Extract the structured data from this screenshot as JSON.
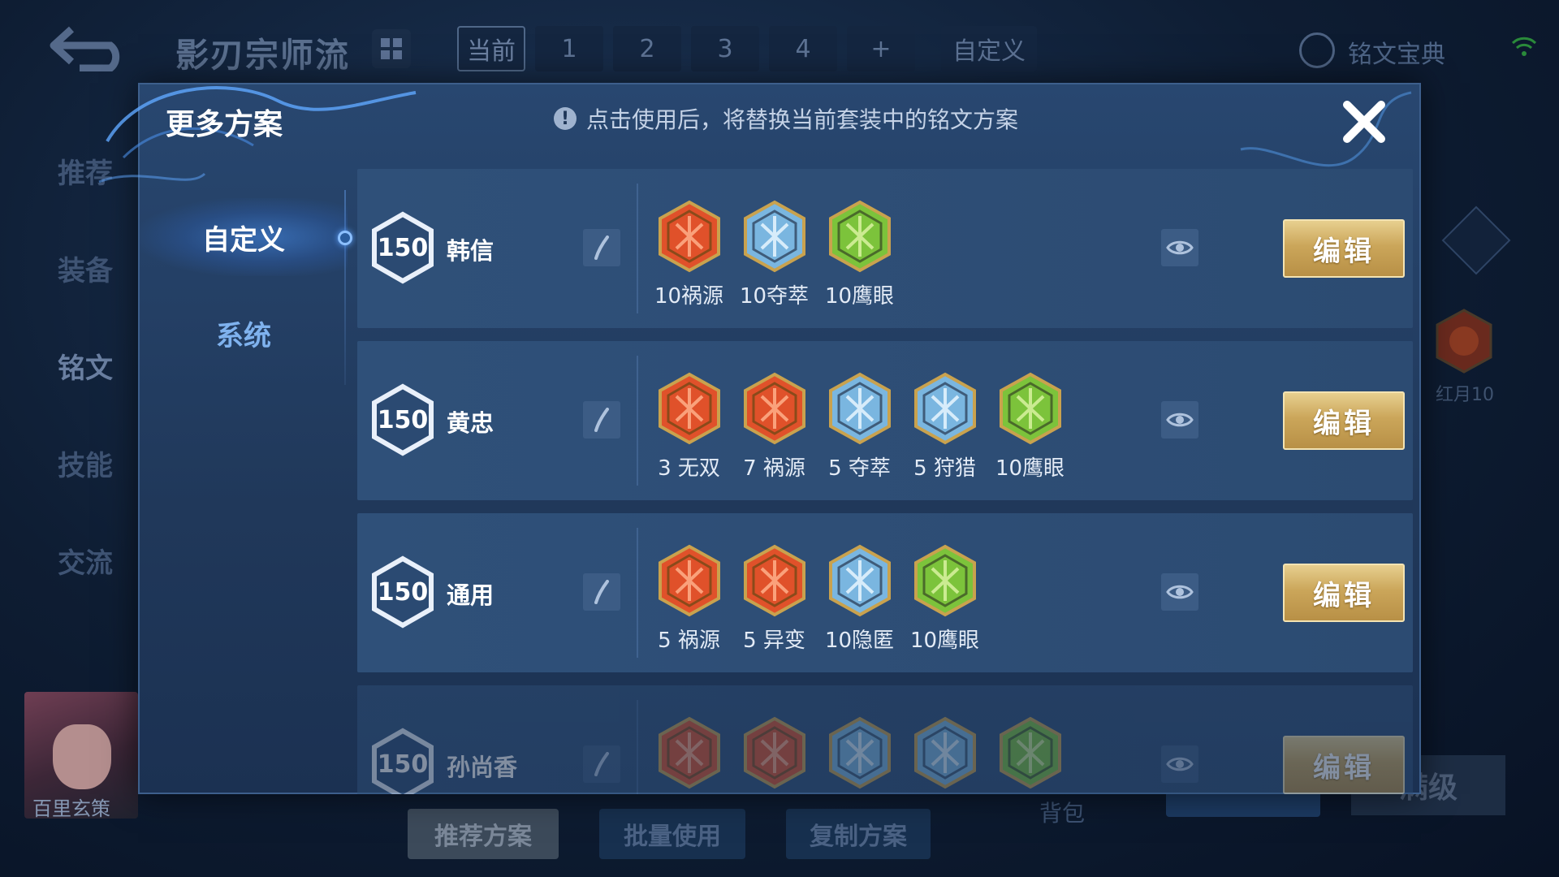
{
  "top_bar": {
    "title": "影刃宗师流",
    "tabs": [
      "当前",
      "1",
      "2",
      "3",
      "4",
      "+"
    ],
    "custom_tab": "自定义",
    "codex_label": "铭文宝典"
  },
  "left_nav": [
    "推荐",
    "装备",
    "铭文",
    "技能",
    "交流"
  ],
  "hero": {
    "name": "百里玄策"
  },
  "side": {
    "gem_label": "红月10"
  },
  "bottom": {
    "recommend": "推荐方案",
    "batch_use": "批量使用",
    "copy_plan": "复制方案",
    "bag": "背包",
    "full_level": "满级"
  },
  "modal": {
    "title": "更多方案",
    "notice_icon": "!",
    "notice": "点击使用后，将替换当前套装中的铭文方案",
    "tabs": [
      "自定义",
      "系统"
    ],
    "active_tab": "自定义",
    "edit_label": "编辑",
    "plans": [
      {
        "level": "150",
        "name": "韩信",
        "runes": [
          {
            "icon": "red-rune-icon",
            "label": "10祸源"
          },
          {
            "icon": "blue-rune-icon",
            "label": "10夺萃"
          },
          {
            "icon": "green-rune-icon",
            "label": "10鹰眼"
          }
        ]
      },
      {
        "level": "150",
        "name": "黄忠",
        "runes": [
          {
            "icon": "red-rune-icon",
            "label": "3 无双"
          },
          {
            "icon": "red-rune-icon",
            "label": "7 祸源"
          },
          {
            "icon": "blue-rune-icon",
            "label": "5 夺萃"
          },
          {
            "icon": "blue-rune-icon",
            "label": "5 狩猎"
          },
          {
            "icon": "green-rune-icon",
            "label": "10鹰眼"
          }
        ]
      },
      {
        "level": "150",
        "name": "通用",
        "runes": [
          {
            "icon": "red-rune-icon",
            "label": "5 祸源"
          },
          {
            "icon": "red-rune-icon",
            "label": "5 异变"
          },
          {
            "icon": "blue-rune-icon",
            "label": "10隐匿"
          },
          {
            "icon": "green-rune-icon",
            "label": "10鹰眼"
          }
        ]
      },
      {
        "level": "150",
        "name": "孙尚香",
        "runes": [
          {
            "icon": "red-rune-icon",
            "label": ""
          },
          {
            "icon": "red-rune-icon",
            "label": ""
          },
          {
            "icon": "blue-rune-icon",
            "label": ""
          },
          {
            "icon": "blue-rune-icon",
            "label": ""
          },
          {
            "icon": "green-rune-icon",
            "label": ""
          }
        ]
      }
    ]
  },
  "colors": {
    "red_rune": "#e0512a",
    "blue_rune": "#7ab6e0",
    "green_rune": "#7cc33b",
    "edit_gold": "#cba65a",
    "accent_blue": "#7fb2ee"
  }
}
